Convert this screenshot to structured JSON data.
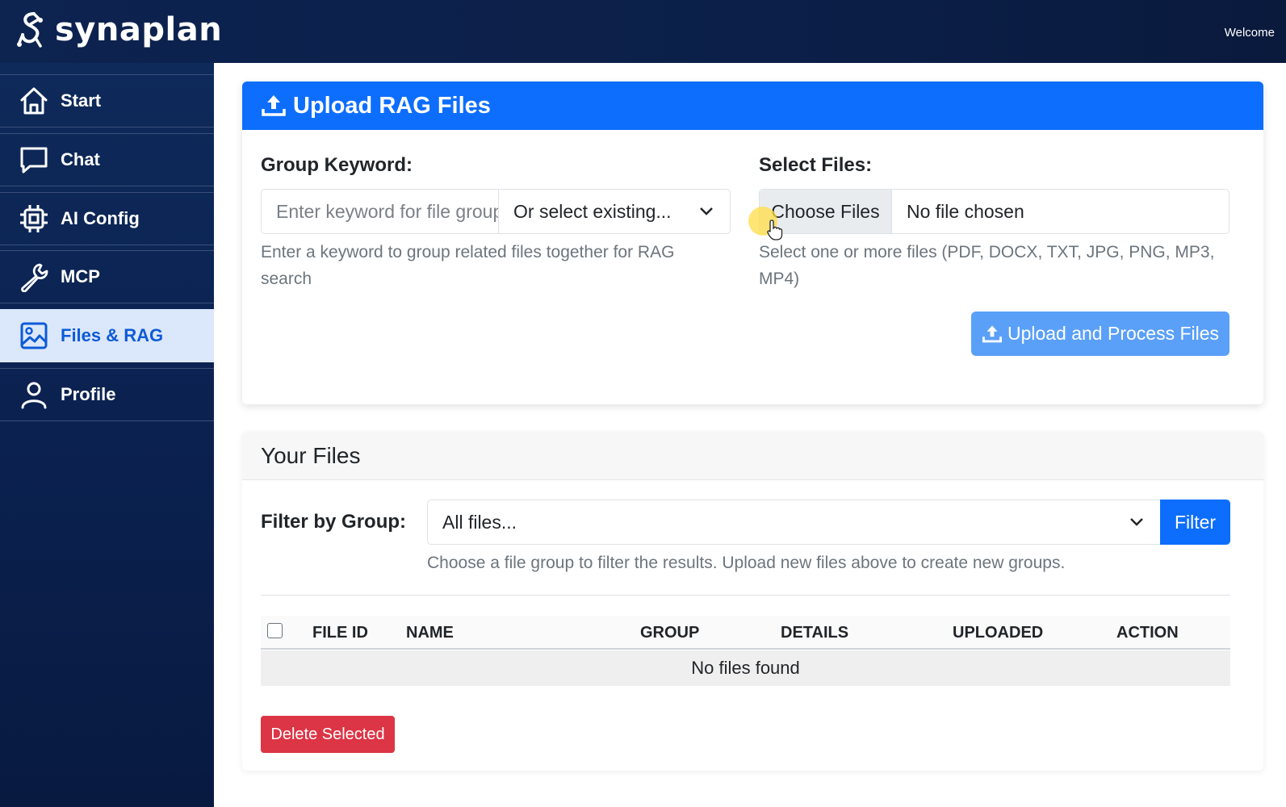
{
  "app": {
    "brand_name": "synaplan",
    "welcome_text": "Welcome"
  },
  "sidebar": {
    "items": [
      {
        "label": "Start",
        "icon": "home-icon"
      },
      {
        "label": "Chat",
        "icon": "chat-icon"
      },
      {
        "label": "AI Config",
        "icon": "chip-icon"
      },
      {
        "label": "MCP",
        "icon": "wrench-icon"
      },
      {
        "label": "Files & RAG",
        "icon": "image-icon",
        "active": true
      },
      {
        "label": "Profile",
        "icon": "person-icon"
      }
    ]
  },
  "upload": {
    "title": "Upload RAG Files",
    "group_keyword_label": "Group Keyword:",
    "keyword_placeholder": "Enter keyword for file group",
    "select_existing_label": "Or select existing...",
    "keyword_help": "Enter a keyword to group related files together for RAG search",
    "select_files_label": "Select Files:",
    "choose_files_label": "Choose Files",
    "no_file_text": "No file chosen",
    "files_help": "Select one or more files (PDF, DOCX, TXT, JPG, PNG, MP3, MP4)",
    "upload_button_label": "Upload and Process Files"
  },
  "files": {
    "title": "Your Files",
    "filter_label": "Filter by Group:",
    "filter_selected": "All files...",
    "filter_button_label": "Filter",
    "filter_help": "Choose a file group to filter the results. Upload new files above to create new groups.",
    "columns": [
      "FILE ID",
      "NAME",
      "GROUP",
      "DETAILS",
      "UPLOADED",
      "ACTION"
    ],
    "empty_text": "No files found",
    "delete_button_label": "Delete Selected"
  },
  "colors": {
    "primary": "#0d6efd",
    "primary_light": "#5aa0f8",
    "danger": "#dc3545",
    "sidebar_bg": "#0b2150",
    "active_nav_bg": "#dbe7fb"
  }
}
